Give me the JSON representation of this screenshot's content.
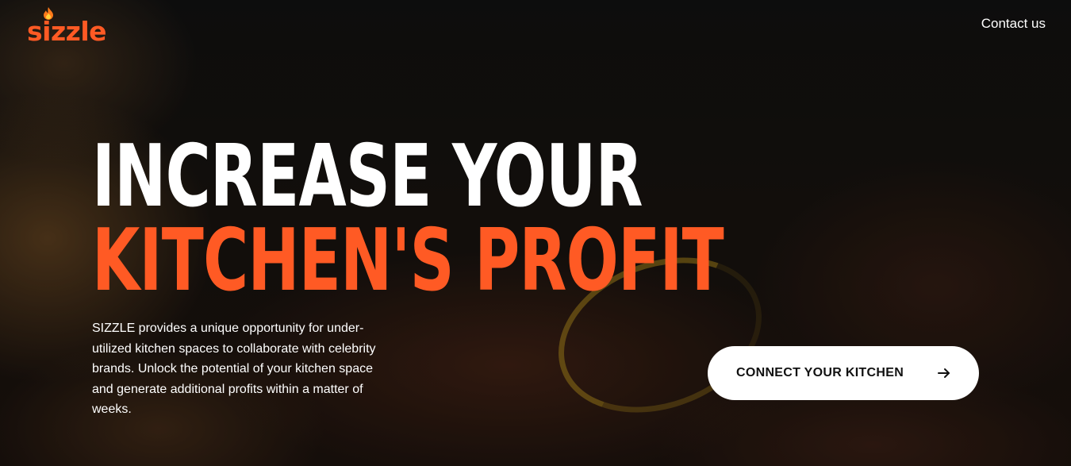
{
  "brand": {
    "name": "sizzle",
    "accent_color": "#ff5a24",
    "logo_icon": "flame-icon"
  },
  "nav": {
    "contact_label": "Contact us"
  },
  "hero": {
    "headline_line1": "INCREASE YOUR",
    "headline_line2": "KITCHEN'S PROFIT",
    "description": "SIZZLE provides a unique opportunity for under-utilized kitchen spaces to collaborate with celebrity brands. Unlock the potential of your kitchen space and generate additional profits within a matter of weeks.",
    "cta_label": "CONNECT YOUR KITCHEN",
    "cta_icon": "arrow-right-icon"
  }
}
